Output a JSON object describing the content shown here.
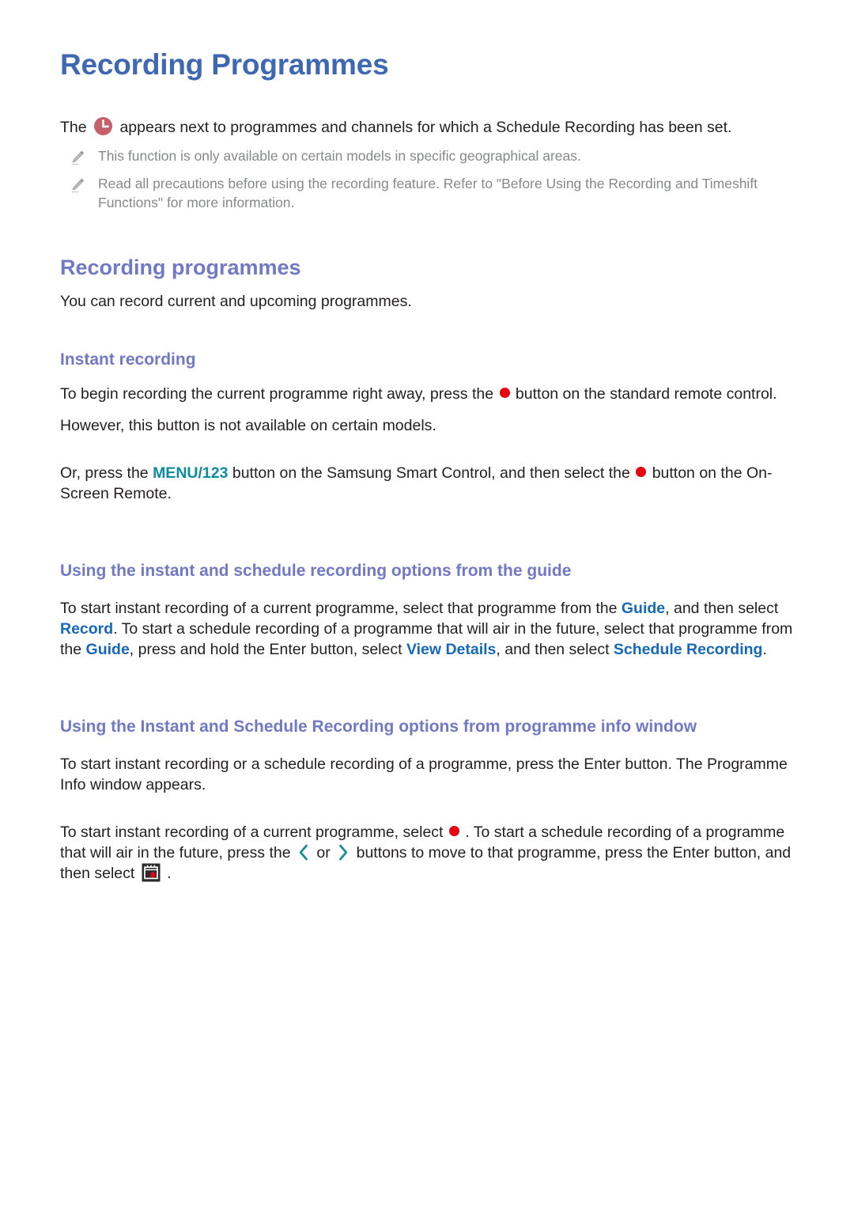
{
  "document": {
    "title": "Recording Programmes",
    "intro": {
      "before_icon": "The",
      "icon": "schedule-clock-icon",
      "after_icon": "appears next to programmes and channels for which a Schedule Recording has been set."
    },
    "notes": [
      {
        "icon": "pencil-note-icon",
        "text": "This function is only available on certain models in specific geographical areas."
      },
      {
        "icon": "pencil-note-icon",
        "text": "Read all precautions before using the recording feature. Refer to \"Before Using the Recording and Timeshift Functions\" for more information."
      }
    ],
    "section_recording_programmes": {
      "heading": "Recording programmes",
      "body": "You can record current and upcoming programmes."
    },
    "section_instant_recording": {
      "heading": "Instant recording",
      "para1_part1": "To begin recording the current programme right away, press the",
      "para1_icon": "record-dot-icon",
      "para1_part2": "button on the standard remote control.",
      "para2": "However, this button is not available on certain models.",
      "para3_part1": "Or, press the",
      "para3_key": "MENU/123",
      "para3_part2": "button on the Samsung Smart Control, and then select the",
      "para3_icon": "record-dot-icon",
      "para3_part3": "button on the On-Screen Remote."
    },
    "section_guide_options": {
      "heading": "Using the instant and schedule recording options from the guide",
      "para_part1": "To start instant recording of a current programme, select that programme from the",
      "link_guide_1": "Guide",
      "para_part2": ", and then select",
      "link_record": "Record",
      "para_part3": ". To start a schedule recording of a programme that will air in the future, select that programme from the",
      "link_guide_2": "Guide",
      "para_part4": ", press and hold the Enter button, select",
      "link_view_details": "View Details",
      "para_part5": ", and then select",
      "link_schedule_recording": "Schedule Recording",
      "para_part6": "."
    },
    "section_info_window": {
      "heading": "Using the Instant and Schedule Recording options from programme info window",
      "para1": "To start instant recording or a schedule recording of a programme, press the Enter button. The Programme Info window appears.",
      "para2_part1": "To start instant recording of a current programme, select",
      "para2_icon1": "record-dot-icon",
      "para2_part2": ". To start a schedule recording of a programme that will air in the future, press the",
      "para2_icon2": "chevron-left-icon",
      "para2_part3": "or",
      "para2_icon3": "chevron-right-icon",
      "para2_part4": "buttons to move to that programme, press the Enter button, and then select",
      "para2_icon4": "schedule-recording-calendar-icon",
      "para2_part5": "."
    }
  },
  "colors": {
    "title_blue": "#3f68b2",
    "heading_periwinkle": "#7179c4",
    "key_teal": "#0c8c9e",
    "link_blue": "#1668b8",
    "record_red": "#e60012",
    "clock_rose": "#c4606a",
    "note_grey": "#86888a",
    "body_black": "#231f20"
  }
}
